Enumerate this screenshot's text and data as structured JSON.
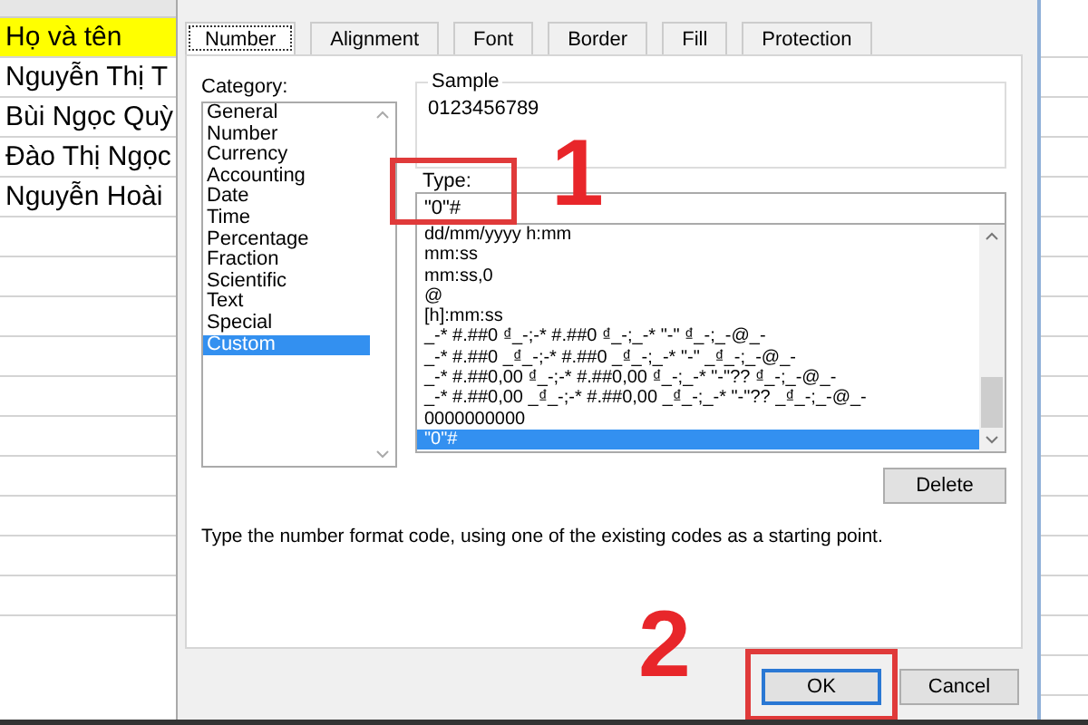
{
  "sheet": {
    "cells": [
      {
        "text": "Họ và tên",
        "highlighted": true
      },
      {
        "text": "Nguyễn Thị T",
        "highlighted": false
      },
      {
        "text": "Bùi Ngọc Quỳ",
        "highlighted": false
      },
      {
        "text": "Đào Thị Ngọc",
        "highlighted": false
      },
      {
        "text": "Nguyễn Hoài",
        "highlighted": false
      }
    ]
  },
  "tabs": [
    {
      "label": "Number",
      "selected": true
    },
    {
      "label": "Alignment",
      "selected": false
    },
    {
      "label": "Font",
      "selected": false
    },
    {
      "label": "Border",
      "selected": false
    },
    {
      "label": "Fill",
      "selected": false
    },
    {
      "label": "Protection",
      "selected": false
    }
  ],
  "category": {
    "label": "Category:",
    "items": [
      {
        "label": "General",
        "selected": false
      },
      {
        "label": "Number",
        "selected": false
      },
      {
        "label": "Currency",
        "selected": false
      },
      {
        "label": "Accounting",
        "selected": false
      },
      {
        "label": "Date",
        "selected": false
      },
      {
        "label": "Time",
        "selected": false
      },
      {
        "label": "Percentage",
        "selected": false
      },
      {
        "label": "Fraction",
        "selected": false
      },
      {
        "label": "Scientific",
        "selected": false
      },
      {
        "label": "Text",
        "selected": false
      },
      {
        "label": "Special",
        "selected": false
      },
      {
        "label": "Custom",
        "selected": true
      }
    ]
  },
  "sample": {
    "label": "Sample",
    "value": "0123456789"
  },
  "type": {
    "label": "Type:",
    "value": "\"0\"#"
  },
  "format_codes": [
    {
      "code": "dd/mm/yyyy h:mm",
      "selected": false
    },
    {
      "code": "mm:ss",
      "selected": false
    },
    {
      "code": "mm:ss,0",
      "selected": false
    },
    {
      "code": "@",
      "selected": false
    },
    {
      "code": "[h]:mm:ss",
      "selected": false
    },
    {
      "code": "_-* #.##0 ₫_-;-* #.##0 ₫_-;_-* \"-\" ₫_-;_-@_-",
      "selected": false
    },
    {
      "code": "_-* #.##0 _₫_-;-* #.##0 _₫_-;_-* \"-\" _₫_-;_-@_-",
      "selected": false
    },
    {
      "code": "_-* #.##0,00 ₫_-;-* #.##0,00 ₫_-;_-* \"-\"?? ₫_-;_-@_-",
      "selected": false
    },
    {
      "code": "_-* #.##0,00 _₫_-;-* #.##0,00 _₫_-;_-* \"-\"?? _₫_-;_-@_-",
      "selected": false
    },
    {
      "code": "0000000000",
      "selected": false
    },
    {
      "code": "\"0\"#",
      "selected": true
    }
  ],
  "delete_button": "Delete",
  "description": "Type the number format code, using one of the existing codes as a starting point.",
  "buttons": [
    {
      "label": "OK",
      "default": true
    },
    {
      "label": "Cancel",
      "default": false
    }
  ],
  "annotations": [
    {
      "number": "1"
    },
    {
      "number": "2"
    }
  ]
}
